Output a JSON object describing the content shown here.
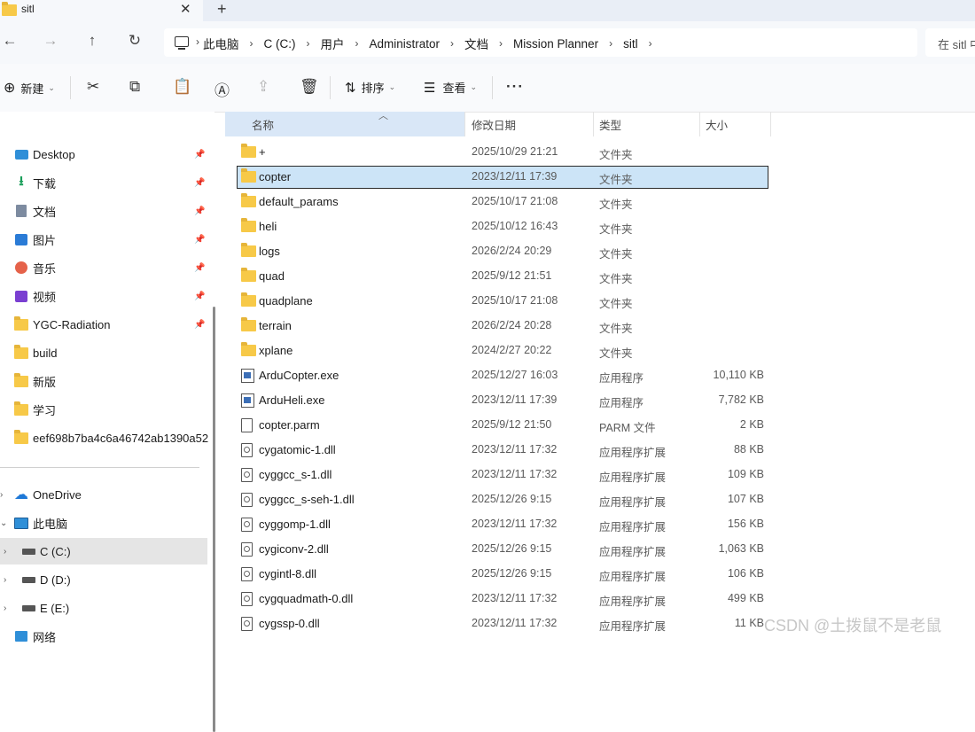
{
  "tab": {
    "title": "sitl",
    "close": "✕",
    "add": "+"
  },
  "nav": {
    "back": "←",
    "forward": "→",
    "up": "↑",
    "refresh": "↻"
  },
  "breadcrumb": [
    "此电脑",
    "C (C:)",
    "用户",
    "Administrator",
    "文档",
    "Mission Planner",
    "sitl"
  ],
  "search": {
    "placeholder": "在 sitl 中搜索"
  },
  "toolbar": {
    "new_label": "新建",
    "sort_label": "排序",
    "view_label": "查看",
    "more_label": "···"
  },
  "sidebar": {
    "quick_access": [
      {
        "label": "Desktop",
        "icon": "desktop-icon",
        "pinned": true
      },
      {
        "label": "下载",
        "icon": "download-icon",
        "pinned": true
      },
      {
        "label": "文档",
        "icon": "documents-icon",
        "pinned": true
      },
      {
        "label": "图片",
        "icon": "pictures-icon",
        "pinned": true
      },
      {
        "label": "音乐",
        "icon": "music-icon",
        "pinned": true
      },
      {
        "label": "视频",
        "icon": "videos-icon",
        "pinned": true
      },
      {
        "label": "YGC-Radiation",
        "icon": "folder-icon",
        "pinned": true
      },
      {
        "label": "build",
        "icon": "folder-icon",
        "pinned": false
      },
      {
        "label": "新版",
        "icon": "folder-icon",
        "pinned": false
      },
      {
        "label": "学习",
        "icon": "folder-icon",
        "pinned": false
      },
      {
        "label": "eef698b7ba4c6a46742ab1390a52",
        "icon": "folder-icon",
        "pinned": false
      }
    ],
    "locations": [
      {
        "label": "OneDrive",
        "icon": "onedrive-icon"
      },
      {
        "label": "此电脑",
        "icon": "this-pc-icon"
      },
      {
        "label": "C (C:)",
        "icon": "drive-icon",
        "selected": true
      },
      {
        "label": "D (D:)",
        "icon": "drive-icon"
      },
      {
        "label": "E (E:)",
        "icon": "drive-icon"
      },
      {
        "label": "网络",
        "icon": "network-icon"
      }
    ]
  },
  "columns": {
    "name": "名称",
    "date": "修改日期",
    "type": "类型",
    "size": "大小"
  },
  "files": [
    {
      "name": "+",
      "date": "2025/10/29 21:21",
      "type": "文件夹",
      "size": "",
      "icon": "folder"
    },
    {
      "name": "copter",
      "date": "2023/12/11 17:39",
      "type": "文件夹",
      "size": "",
      "icon": "folder",
      "selected": true
    },
    {
      "name": "default_params",
      "date": "2025/10/17 21:08",
      "type": "文件夹",
      "size": "",
      "icon": "folder"
    },
    {
      "name": "heli",
      "date": "2025/10/12 16:43",
      "type": "文件夹",
      "size": "",
      "icon": "folder"
    },
    {
      "name": "logs",
      "date": "2026/2/24 20:29",
      "type": "文件夹",
      "size": "",
      "icon": "folder"
    },
    {
      "name": "quad",
      "date": "2025/9/12 21:51",
      "type": "文件夹",
      "size": "",
      "icon": "folder"
    },
    {
      "name": "quadplane",
      "date": "2025/10/17 21:08",
      "type": "文件夹",
      "size": "",
      "icon": "folder"
    },
    {
      "name": "terrain",
      "date": "2026/2/24 20:28",
      "type": "文件夹",
      "size": "",
      "icon": "folder"
    },
    {
      "name": "xplane",
      "date": "2024/2/27 20:22",
      "type": "文件夹",
      "size": "",
      "icon": "folder"
    },
    {
      "name": "ArduCopter.exe",
      "date": "2025/12/27 16:03",
      "type": "应用程序",
      "size": "10,110 KB",
      "icon": "exe"
    },
    {
      "name": "ArduHeli.exe",
      "date": "2023/12/11 17:39",
      "type": "应用程序",
      "size": "7,782 KB",
      "icon": "exe"
    },
    {
      "name": "copter.parm",
      "date": "2025/9/12 21:50",
      "type": "PARM 文件",
      "size": "2 KB",
      "icon": "doc"
    },
    {
      "name": "cygatomic-1.dll",
      "date": "2023/12/11 17:32",
      "type": "应用程序扩展",
      "size": "88 KB",
      "icon": "dll"
    },
    {
      "name": "cyggcc_s-1.dll",
      "date": "2023/12/11 17:32",
      "type": "应用程序扩展",
      "size": "109 KB",
      "icon": "dll"
    },
    {
      "name": "cyggcc_s-seh-1.dll",
      "date": "2025/12/26 9:15",
      "type": "应用程序扩展",
      "size": "107 KB",
      "icon": "dll"
    },
    {
      "name": "cyggomp-1.dll",
      "date": "2023/12/11 17:32",
      "type": "应用程序扩展",
      "size": "156 KB",
      "icon": "dll"
    },
    {
      "name": "cygiconv-2.dll",
      "date": "2025/12/26 9:15",
      "type": "应用程序扩展",
      "size": "1,063 KB",
      "icon": "dll"
    },
    {
      "name": "cygintl-8.dll",
      "date": "2025/12/26 9:15",
      "type": "应用程序扩展",
      "size": "106 KB",
      "icon": "dll"
    },
    {
      "name": "cygquadmath-0.dll",
      "date": "2023/12/11 17:32",
      "type": "应用程序扩展",
      "size": "499 KB",
      "icon": "dll"
    },
    {
      "name": "cygssp-0.dll",
      "date": "2023/12/11 17:32",
      "type": "应用程序扩展",
      "size": "11 KB",
      "icon": "dll"
    }
  ],
  "watermark": "CSDN @土拨鼠不是老鼠"
}
